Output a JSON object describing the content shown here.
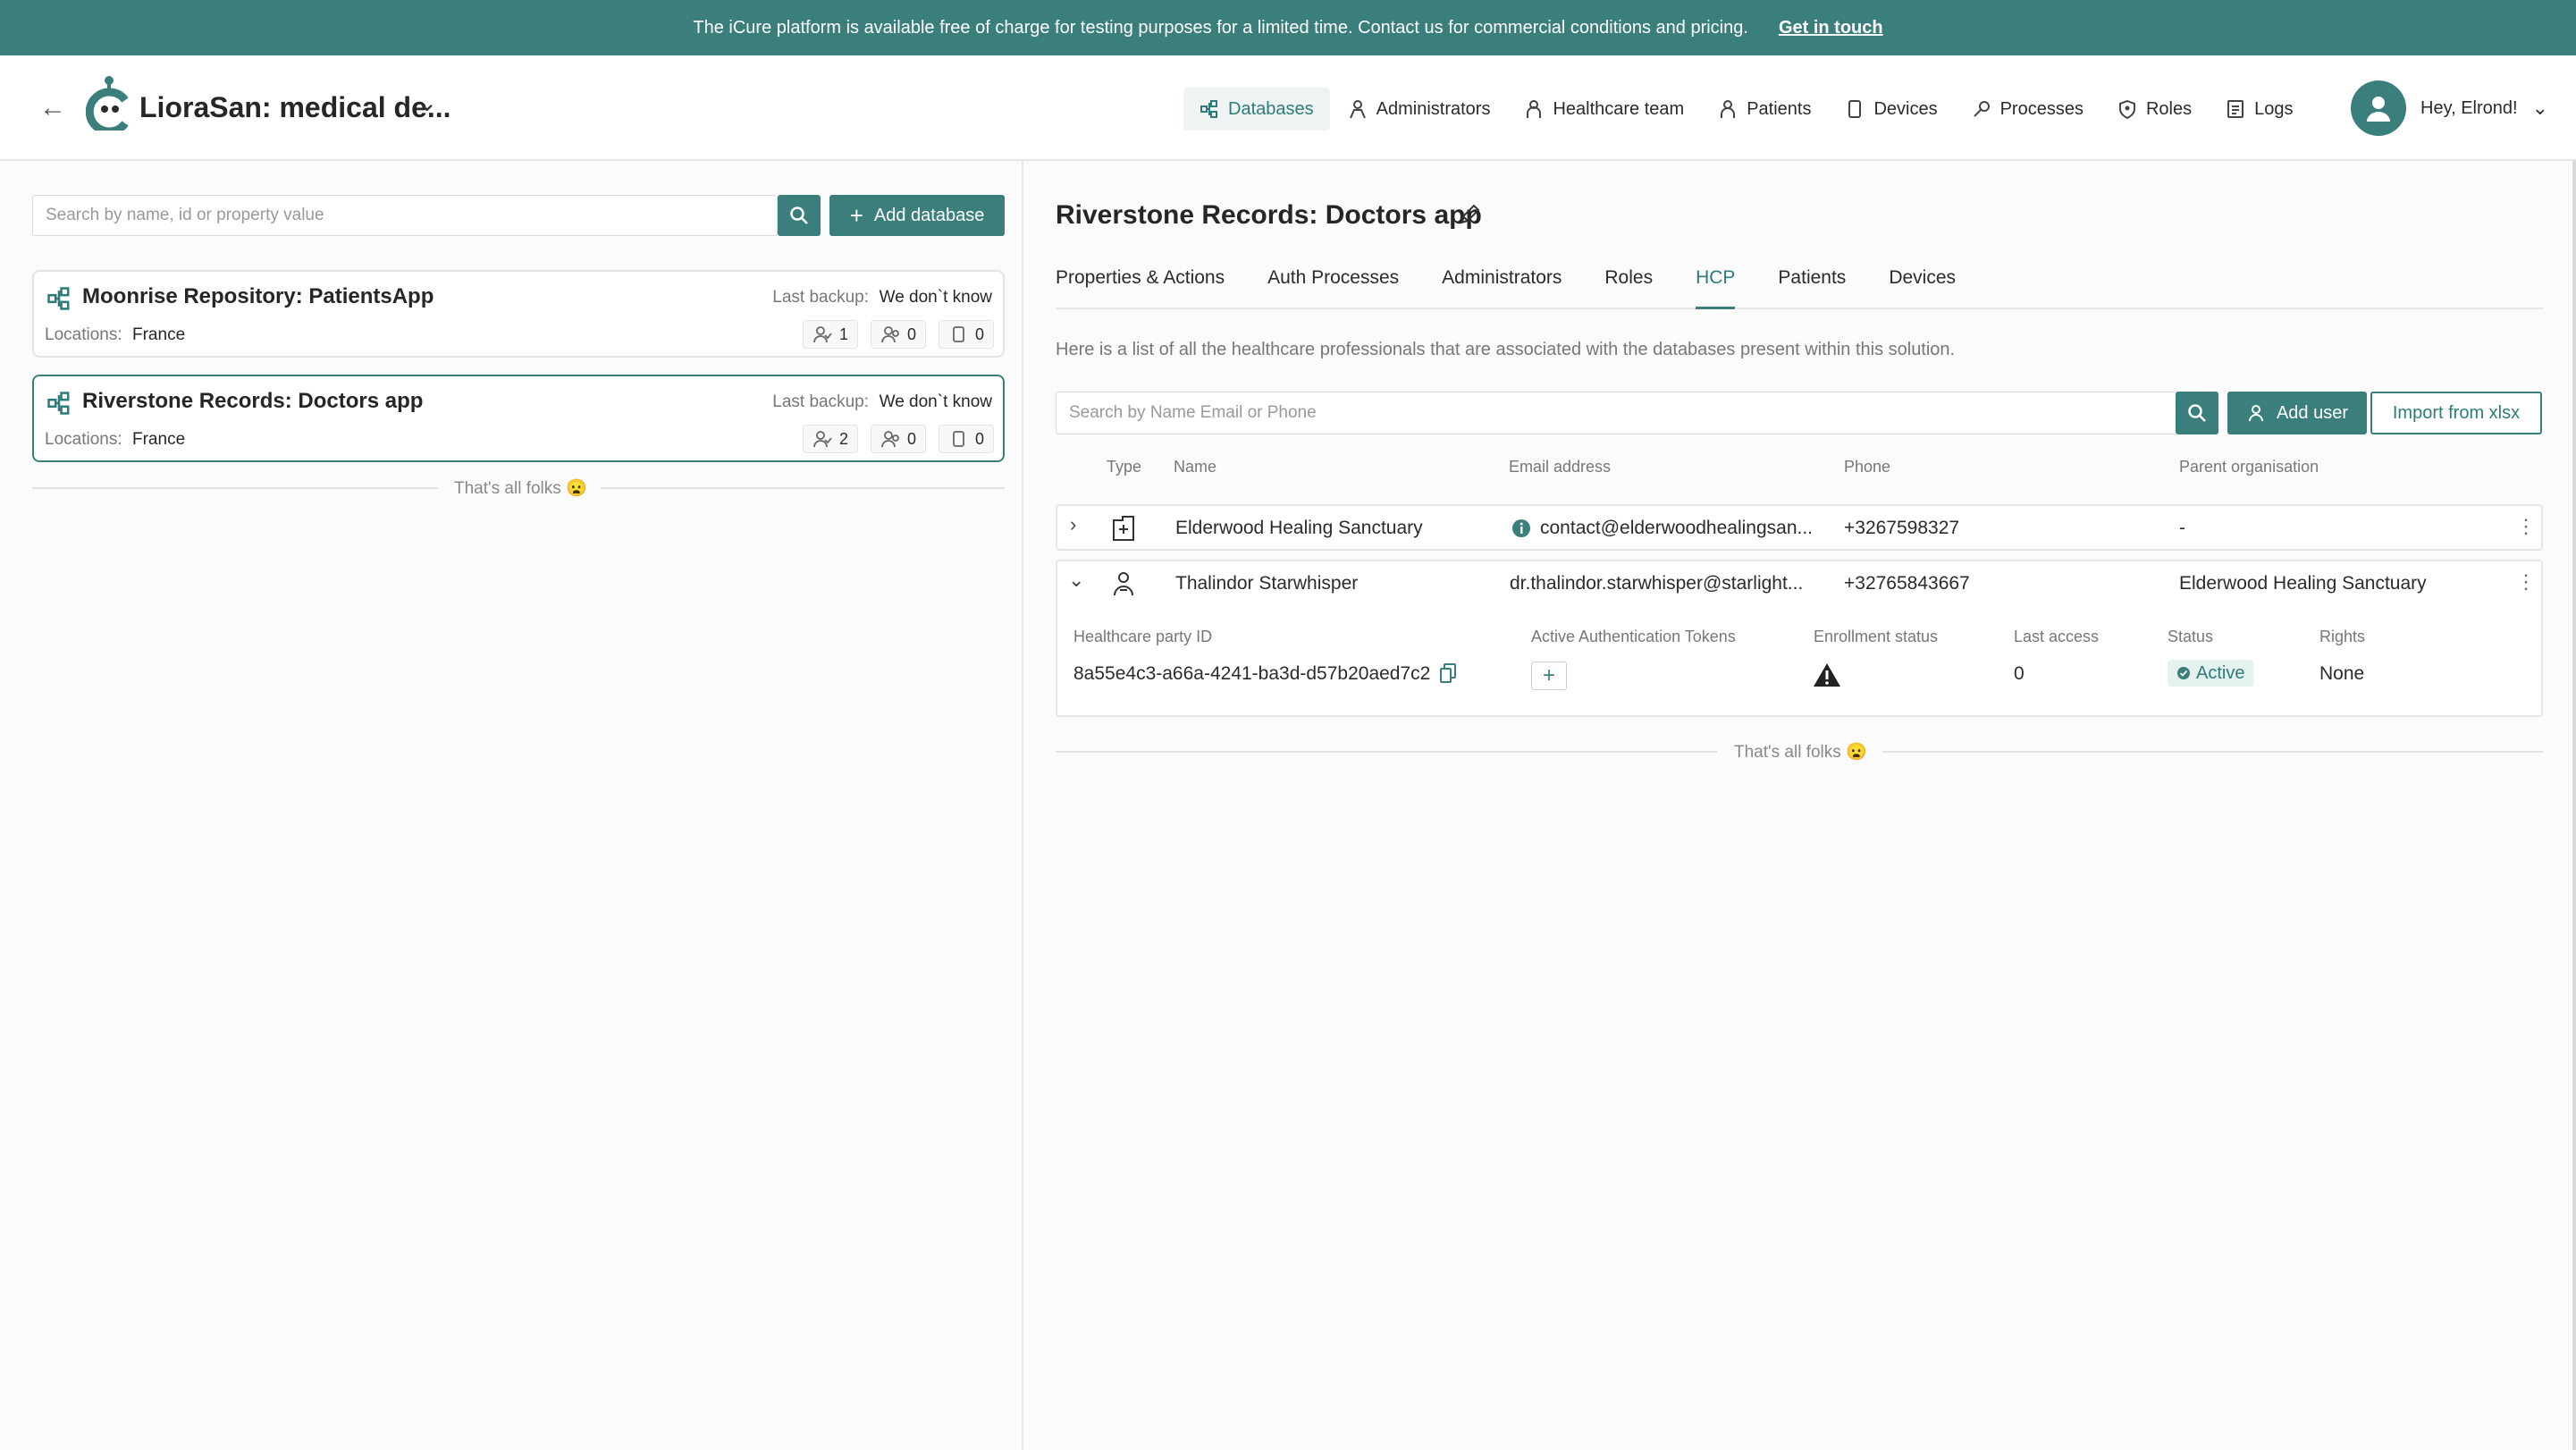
{
  "banner": {
    "message": "The iCure platform is available free of charge for testing purposes for a limited time. Contact us for commercial conditions and pricing.",
    "link": "Get in touch"
  },
  "header": {
    "app_title": "LioraSan: medical de...",
    "nav": [
      {
        "label": "Databases",
        "icon": "databases-icon",
        "active": true
      },
      {
        "label": "Administrators",
        "icon": "administrator-icon"
      },
      {
        "label": "Healthcare team",
        "icon": "healthcare-team-icon"
      },
      {
        "label": "Patients",
        "icon": "patient-icon"
      },
      {
        "label": "Devices",
        "icon": "device-icon"
      },
      {
        "label": "Processes",
        "icon": "process-icon"
      },
      {
        "label": "Roles",
        "icon": "role-icon"
      },
      {
        "label": "Logs",
        "icon": "logs-icon"
      }
    ],
    "user_greeting": "Hey, Elrond!"
  },
  "left": {
    "search_placeholder": "Search by name, id or property value",
    "add_database": "Add database",
    "databases": [
      {
        "name": "Moonrise Repository: PatientsApp",
        "backup_label": "Last backup:",
        "backup_value": "We don`t know",
        "locations_label": "Locations:",
        "locations": "France",
        "hcp_count": "1",
        "patient_count": "0",
        "device_count": "0",
        "selected": false
      },
      {
        "name": "Riverstone Records: Doctors app",
        "backup_label": "Last backup:",
        "backup_value": "We don`t know",
        "locations_label": "Locations:",
        "locations": "France",
        "hcp_count": "2",
        "patient_count": "0",
        "device_count": "0",
        "selected": true
      }
    ],
    "end_text": "That's all folks 😦"
  },
  "right": {
    "title": "Riverstone Records: Doctors app",
    "tabs": [
      "Properties & Actions",
      "Auth Processes",
      "Administrators",
      "Roles",
      "HCP",
      "Patients",
      "Devices"
    ],
    "active_tab": "HCP",
    "description": "Here is a list of all the healthcare professionals that are associated with the databases present within this solution.",
    "search_placeholder": "Search by Name Email or Phone",
    "add_user": "Add user",
    "import": "Import from xlsx",
    "columns": {
      "type": "Type",
      "name": "Name",
      "email": "Email address",
      "phone": "Phone",
      "parent": "Parent organisation"
    },
    "rows": [
      {
        "name": "Elderwood Healing Sanctuary",
        "email": "contact@elderwoodhealingsan...",
        "phone": "+3267598327",
        "parent": "-",
        "type_icon": "organisation-icon",
        "expanded": false
      },
      {
        "name": "Thalindor Starwhisper",
        "email": "dr.thalindor.starwhisper@starlight...",
        "phone": "+32765843667",
        "parent": "Elderwood Healing Sanctuary",
        "type_icon": "person-icon",
        "expanded": true
      }
    ],
    "details": {
      "labels": {
        "hcp_id": "Healthcare party ID",
        "tokens": "Active Authentication Tokens",
        "enrollment": "Enrollment status",
        "last_access": "Last access",
        "status": "Status",
        "rights": "Rights"
      },
      "hcp_id": "8a55e4c3-a66a-4241-ba3d-d57b20aed7c2",
      "last_access": "0",
      "status": "Active",
      "rights": "None"
    },
    "end_text": "That's all folks 😦"
  },
  "colors": {
    "accent": "#3a7f7c",
    "banner": "#3a7f7c"
  }
}
